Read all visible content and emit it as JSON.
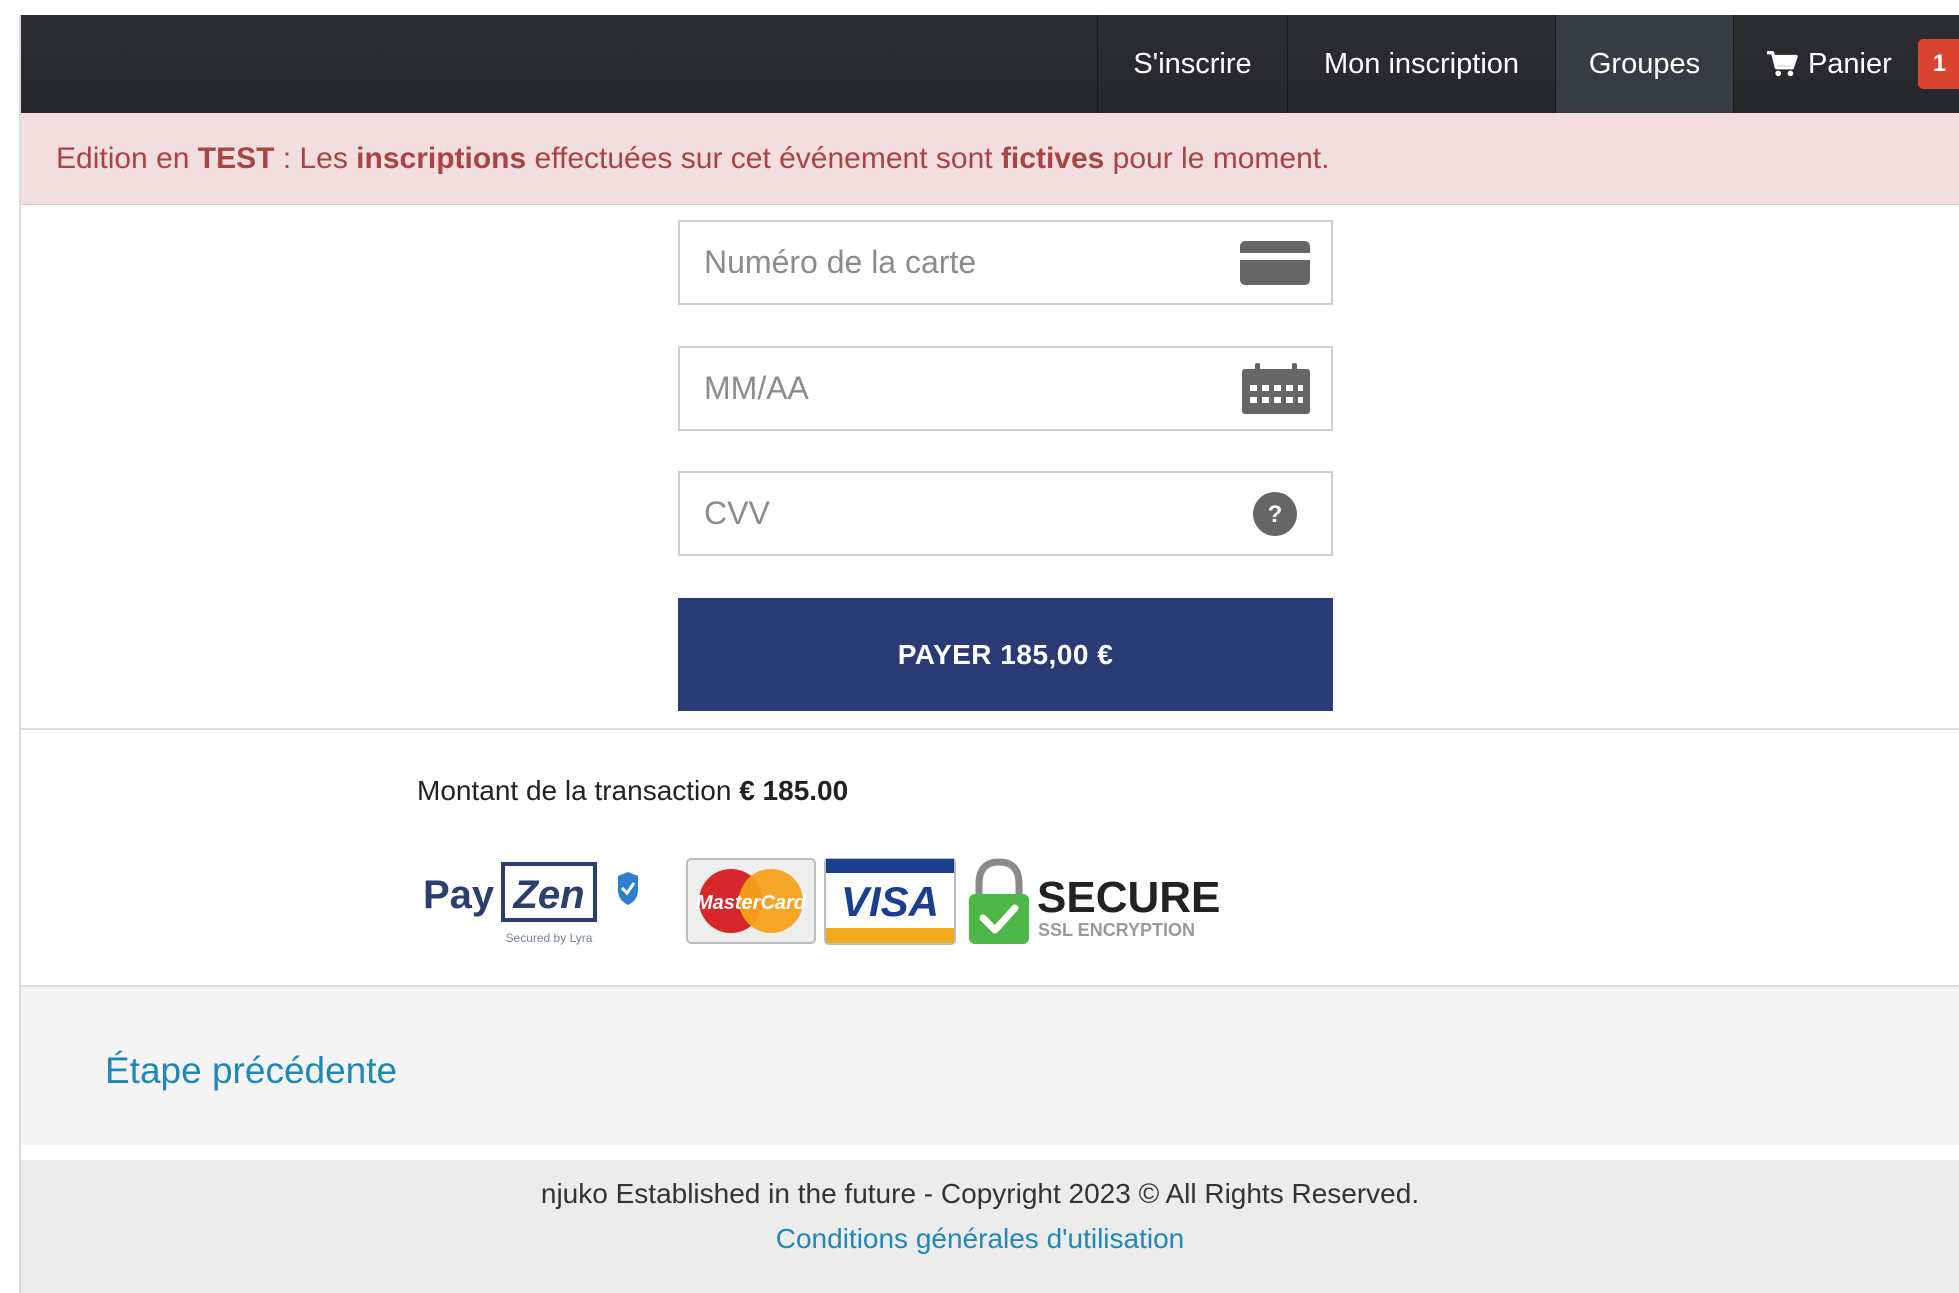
{
  "nav": {
    "items": [
      "S'inscrire",
      "Mon inscription",
      "Groupes"
    ],
    "cart_label": "Panier",
    "cart_count": "1",
    "cart_icon": "cart-icon"
  },
  "banner": {
    "part1": "Edition en ",
    "bold1": "TEST",
    "part2": " : Les ",
    "bold2": "inscriptions",
    "part3": " effectuées sur cet événement sont ",
    "bold3": "fictives",
    "part4": " pour le moment."
  },
  "form": {
    "card_number_placeholder": "Numéro de la carte",
    "card_icon": "credit-card-icon",
    "expiry_placeholder": "MM/AA",
    "expiry_icon": "calendar-icon",
    "cvv_placeholder": "CVV",
    "cvv_icon": "help-icon",
    "pay_label": "PAYER 185,00 €"
  },
  "transaction": {
    "label": "Montant de la transaction ",
    "amount": "€ 185.00"
  },
  "logos": {
    "payzen_pay": "Pay",
    "payzen_zen": "Zen",
    "payzen_tagline": "Secured by Lyra",
    "mastercard": "MasterCard",
    "visa": "VISA",
    "secure_title": "SECURE",
    "secure_subtitle": "SSL ENCRYPTION"
  },
  "previous_step": "Étape précédente",
  "footer": {
    "copyright": "njuko Established in the future - Copyright 2023 © All Rights Reserved.",
    "terms_link": "Conditions générales d'utilisation"
  },
  "colors": {
    "navbar": "#2b2d31",
    "badge": "#d9432f",
    "alert_bg": "#f2dede",
    "alert_text": "#a94442",
    "pay_button": "#293a75",
    "link": "#1f88b8"
  }
}
